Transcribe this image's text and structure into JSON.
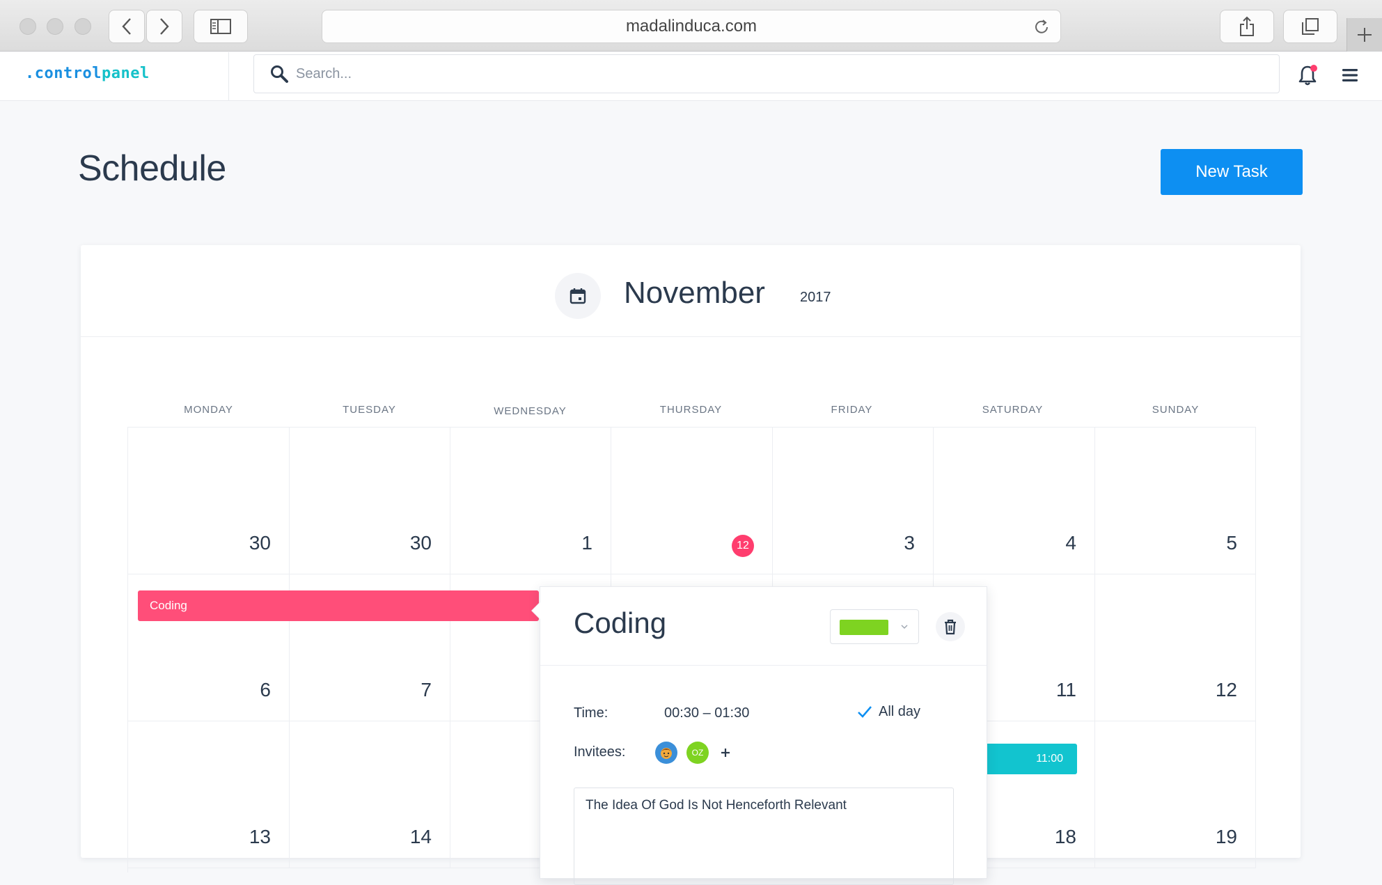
{
  "browser": {
    "url": "madalinduca.com"
  },
  "app": {
    "logo_dot": ".",
    "logo_a": "control",
    "logo_b": "panel",
    "search_placeholder": "Search..."
  },
  "page": {
    "title": "Schedule",
    "new_task_label": "New Task"
  },
  "calendar": {
    "month": "November",
    "year": "2017",
    "weekdays": [
      "MONDAY",
      "TUESDAY",
      "WEDNESDAY",
      "THURSDAY",
      "FRIDAY",
      "SATURDAY",
      "SUNDAY"
    ],
    "weeks": [
      [
        "30",
        "30",
        "1",
        "12",
        "3",
        "4",
        "5"
      ],
      [
        "6",
        "7",
        "",
        "",
        "",
        "11",
        "12"
      ],
      [
        "13",
        "14",
        "",
        "",
        "",
        "18",
        "19"
      ]
    ],
    "today_badge": "12",
    "events": {
      "coding_label": "Coding",
      "teal_label": "11:00"
    }
  },
  "popover": {
    "title": "Coding",
    "color": "#7ed321",
    "time_label": "Time:",
    "time_value": "00:30 – 01:30",
    "allday_label": "All day",
    "allday_checked": true,
    "invitees_label": "Invitees:",
    "invitee_2_initials": "OZ",
    "notes": "The Idea Of God Is Not Henceforth Relevant"
  },
  "colors": {
    "accent": "#0d8ff2",
    "event_pink": "#ff4e79",
    "event_teal": "#12c4cf",
    "today": "#ff3d6e"
  }
}
